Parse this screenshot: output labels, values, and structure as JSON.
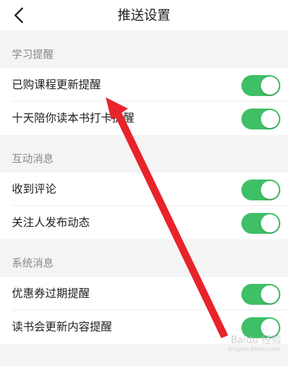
{
  "header": {
    "title": "推送设置"
  },
  "sections": [
    {
      "title": "学习提醒",
      "items": [
        {
          "label": "已购课程更新提醒",
          "on": true
        },
        {
          "label": "十天陪你读本书打卡提醒",
          "on": true
        }
      ]
    },
    {
      "title": "互动消息",
      "items": [
        {
          "label": "收到评论",
          "on": true
        },
        {
          "label": "关注人发布动态",
          "on": true
        }
      ]
    },
    {
      "title": "系统消息",
      "items": [
        {
          "label": "优惠券过期提醒",
          "on": true
        },
        {
          "label": "读书会更新内容提醒",
          "on": true
        }
      ]
    }
  ],
  "colors": {
    "toggle_on": "#3fbf66",
    "annotation_arrow": "#e8232b"
  },
  "watermark": {
    "text": "Baidu 经验",
    "sub": "jingyan.baidu.com"
  }
}
